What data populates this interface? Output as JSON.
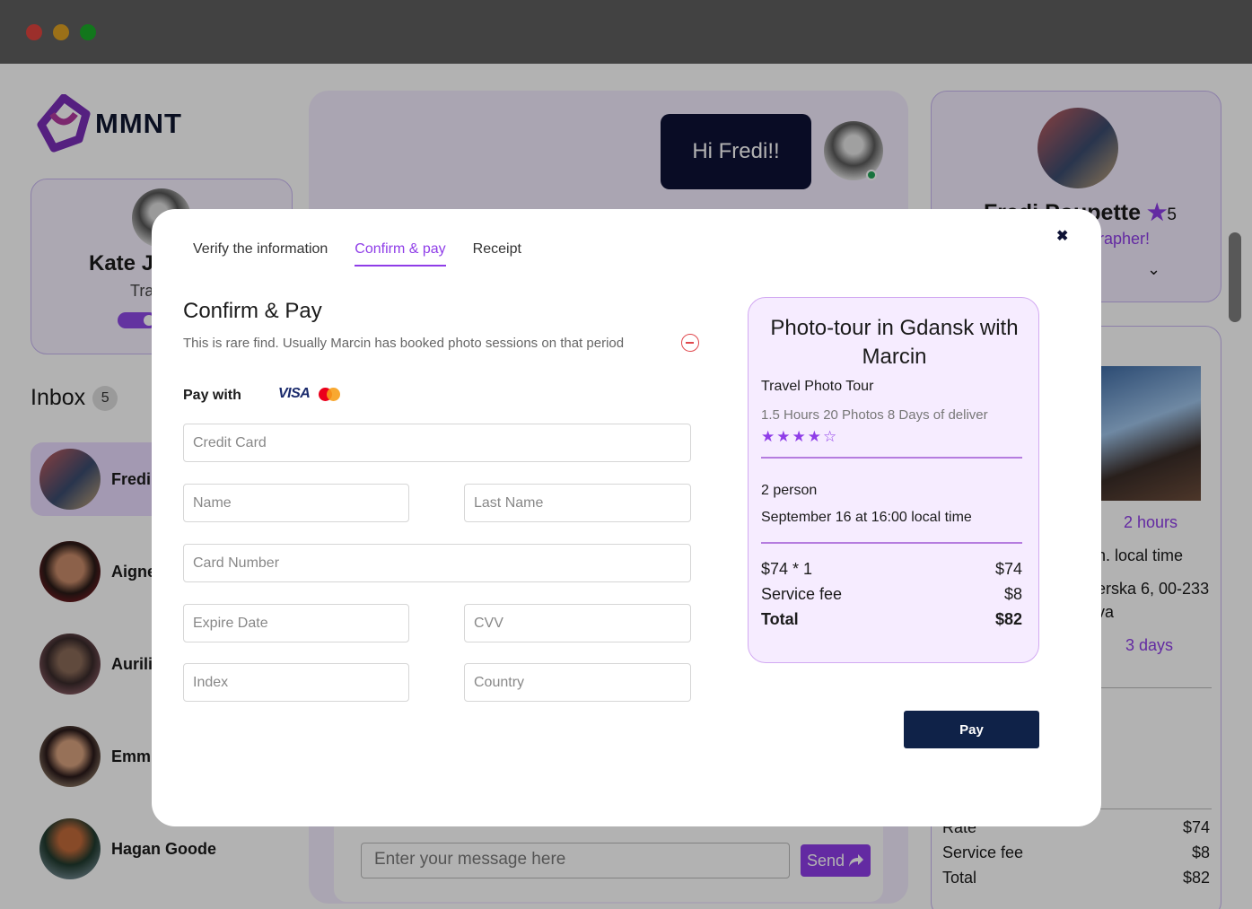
{
  "window": {
    "controls": [
      "close",
      "minimize",
      "zoom"
    ]
  },
  "app": {
    "brand": "MMNT",
    "brand_color": "#8f3de8"
  },
  "profile": {
    "name": "Kate J",
    "role": "Tra"
  },
  "inbox": {
    "title": "Inbox",
    "count": "5",
    "contacts": [
      {
        "name": "Fredi",
        "active": true
      },
      {
        "name": "Aigne"
      },
      {
        "name": "Aurili"
      },
      {
        "name": "Emm"
      },
      {
        "name": "Hagan Goode"
      }
    ]
  },
  "chat": {
    "greeting": "Hi Fredi!!",
    "message_placeholder": "Enter your message here",
    "send_label": "Send"
  },
  "right_profile": {
    "name": "Fredi Poupette",
    "rating": "5",
    "role": "rapher!"
  },
  "details": {
    "duration": "2 hours",
    "time": "n. local time",
    "address_line1": "erska 6, 00-233",
    "address_line2": "va",
    "delivery": "3 days",
    "rate_label": "Rate",
    "rate_value": "$74",
    "fee_label": "Service fee",
    "fee_value": "$8",
    "total_label": "Total",
    "total_value": "$82"
  },
  "modal": {
    "tabs": [
      "Verify the information",
      "Confirm & pay",
      "Receipt"
    ],
    "active_tab": 1,
    "title": "Confirm & Pay",
    "subtitle": "This is rare find. Usually Marcin has booked photo sessions on that period",
    "pay_with": "Pay with",
    "card_brands": [
      "VISA",
      "Mastercard"
    ],
    "fields": {
      "credit_card": "Credit Card",
      "name": "Name",
      "last_name": "Last Name",
      "card_number": "Card Number",
      "expire_date": "Expire Date",
      "cvv": "CVV",
      "index": "Index",
      "country": "Country"
    },
    "pay_label": "Pay"
  },
  "summary": {
    "title": "Photo-tour in Gdansk with Marcin",
    "type": "Travel Photo Tour",
    "meta": "1.5 Hours 20 Photos 8 Days of deliver",
    "rating": 4,
    "rating_max": 5,
    "persons": "2 person",
    "datetime": "September 16 at 16:00 local time",
    "price_label": "$74 * 1",
    "price_value": "$74",
    "fee_label": "Service fee",
    "fee_value": "$8",
    "total_label": "Total",
    "total_value": "$82"
  }
}
